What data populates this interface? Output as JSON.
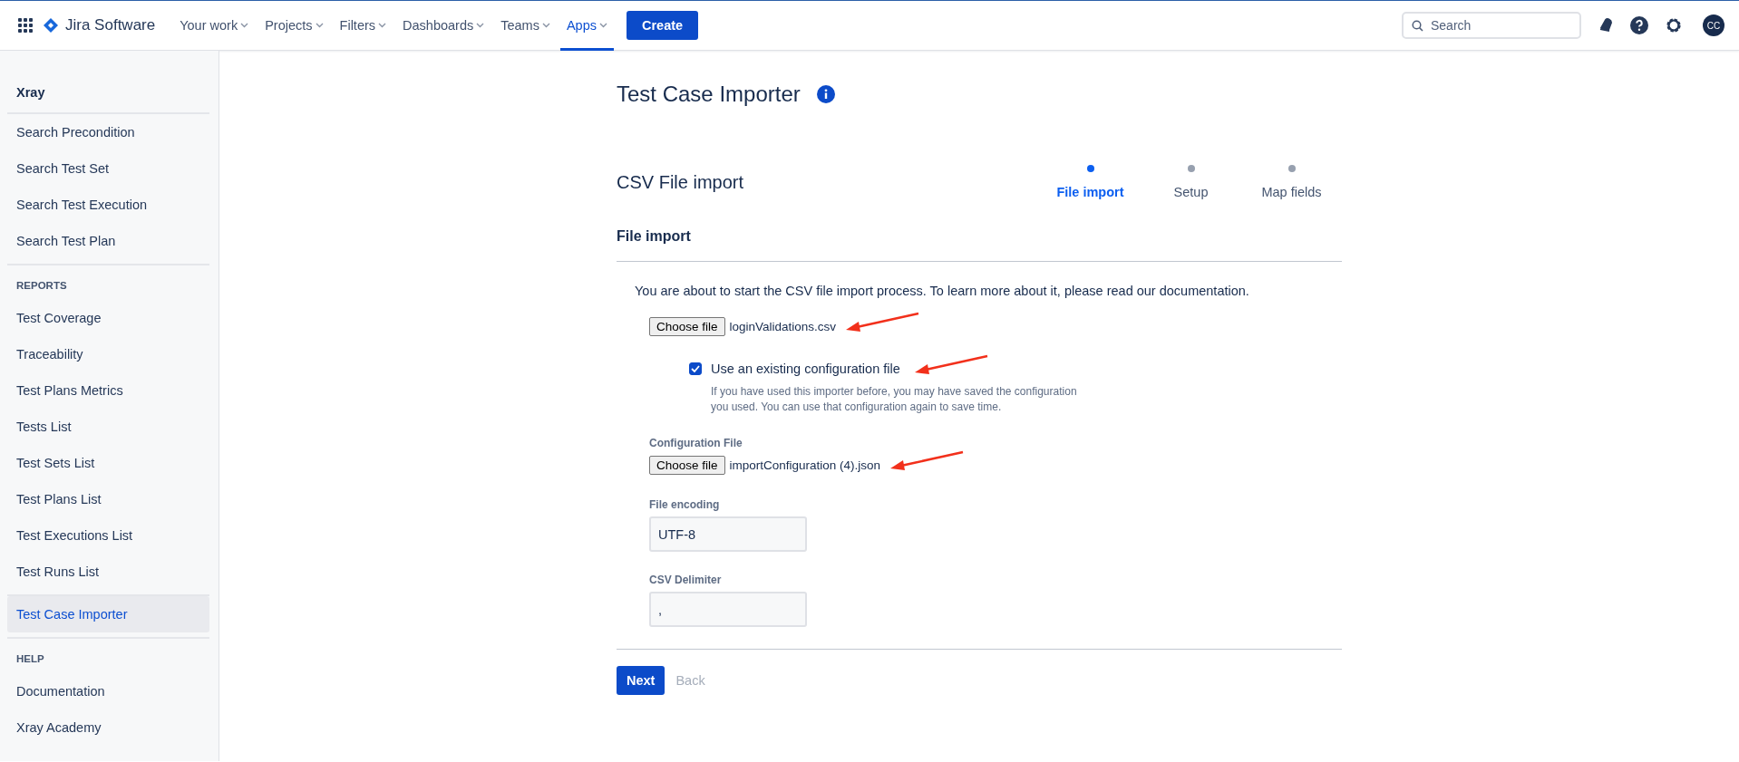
{
  "topbar": {
    "product": "Jira Software",
    "nav": [
      {
        "label": "Your work",
        "selected": false
      },
      {
        "label": "Projects",
        "selected": false
      },
      {
        "label": "Filters",
        "selected": false
      },
      {
        "label": "Dashboards",
        "selected": false
      },
      {
        "label": "Teams",
        "selected": false
      },
      {
        "label": "Apps",
        "selected": true
      }
    ],
    "create": "Create",
    "search": {
      "placeholder": "Search"
    },
    "avatar": "CC"
  },
  "sidebar": {
    "title": "Xray",
    "sections": [
      {
        "items": [
          {
            "label": "Search Precondition",
            "selected": false
          },
          {
            "label": "Search Test Set",
            "selected": false
          },
          {
            "label": "Search Test Execution",
            "selected": false
          },
          {
            "label": "Search Test Plan",
            "selected": false
          }
        ]
      },
      {
        "heading": "REPORTS",
        "items": [
          {
            "label": "Test Coverage",
            "selected": false
          },
          {
            "label": "Traceability",
            "selected": false
          },
          {
            "label": "Test Plans Metrics",
            "selected": false
          },
          {
            "label": "Tests List",
            "selected": false
          },
          {
            "label": "Test Sets List",
            "selected": false
          },
          {
            "label": "Test Plans List",
            "selected": false
          },
          {
            "label": "Test Executions List",
            "selected": false
          },
          {
            "label": "Test Runs List",
            "selected": false
          }
        ]
      },
      {
        "items": [
          {
            "label": "Test Case Importer",
            "selected": true
          }
        ]
      },
      {
        "heading": "HELP",
        "items": [
          {
            "label": "Documentation",
            "selected": false
          },
          {
            "label": "Xray Academy",
            "selected": false
          }
        ]
      }
    ]
  },
  "main": {
    "title": "Test Case Importer",
    "subtitle": "CSV File import",
    "steps": [
      {
        "label": "File import",
        "selected": true
      },
      {
        "label": "Setup",
        "selected": false
      },
      {
        "label": "Map fields",
        "selected": false
      }
    ],
    "section": "File import",
    "intro": "You are about to start the CSV file import process. To learn more about it, please read our documentation.",
    "csv_file": {
      "button": "Choose file",
      "filename": "loginValidations.csv",
      "arrow": true
    },
    "existing_config": {
      "label": "Use an existing configuration file",
      "checked": true,
      "arrow": true,
      "help": "If you have used this importer before, you may have saved the configuration you used. You can use that configuration again to save time."
    },
    "config_file": {
      "label": "Configuration File",
      "button": "Choose file",
      "filename": "importConfiguration (4).json",
      "arrow": true
    },
    "encoding": {
      "label": "File encoding",
      "value": "UTF-8"
    },
    "delimiter": {
      "label": "CSV Delimiter",
      "value": ","
    },
    "buttons": {
      "next": "Next",
      "back": "Back"
    }
  }
}
